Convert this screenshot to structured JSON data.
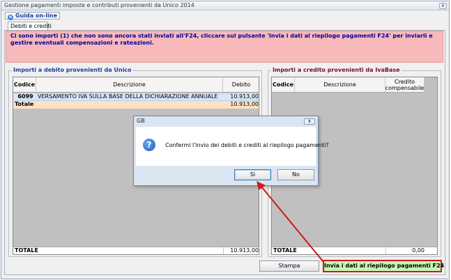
{
  "window": {
    "title": "Gestione pagamenti imposte e contributi provenienti da Unico 2014",
    "close_glyph": "x"
  },
  "help_button": {
    "label": "Guida on-line"
  },
  "tabs": [
    {
      "label": "Debiti e crediti"
    }
  ],
  "banner": {
    "text": "Ci sono importi (1) che non sono ancora stati inviati all'F24, cliccare sul pulsante 'Invia i dati al riepilogo pagamenti F24' per inviarli e gestire eventuali compensazioni e rateazioni."
  },
  "debiti": {
    "title": "Importi a debito provenienti da Unico",
    "columns": [
      "Codice",
      "Descrizione",
      "Debito"
    ],
    "rows": [
      {
        "codice": "6099",
        "descrizione": "VERSAMENTO IVA SULLA BASE DELLA DICHIARAZIONE ANNUALE",
        "debito": "10.913,00"
      }
    ],
    "subtotal": {
      "label": "Totale",
      "value": "10.913,00"
    },
    "total": {
      "label": "TOTALE",
      "value": "10.913,00"
    }
  },
  "crediti": {
    "title": "Importi a credito provenienti da IvaBase",
    "columns": [
      "Codice",
      "Descrizione",
      "Credito compensabile"
    ],
    "total": {
      "label": "TOTALE",
      "value": "0,00"
    }
  },
  "buttons": {
    "stampa": "Stampa",
    "invia": "Invia i dati al riepilogo pagamenti F24"
  },
  "dialog": {
    "title": "GB",
    "message": "Confermi l'invio dei debiti e crediti al riepilogo pagamenti?",
    "yes": "Sì",
    "no": "No"
  },
  "colors": {
    "banner_bg": "#f7b9b9",
    "highlight": "#d01818",
    "invia_bg": "#c8f5b4"
  }
}
